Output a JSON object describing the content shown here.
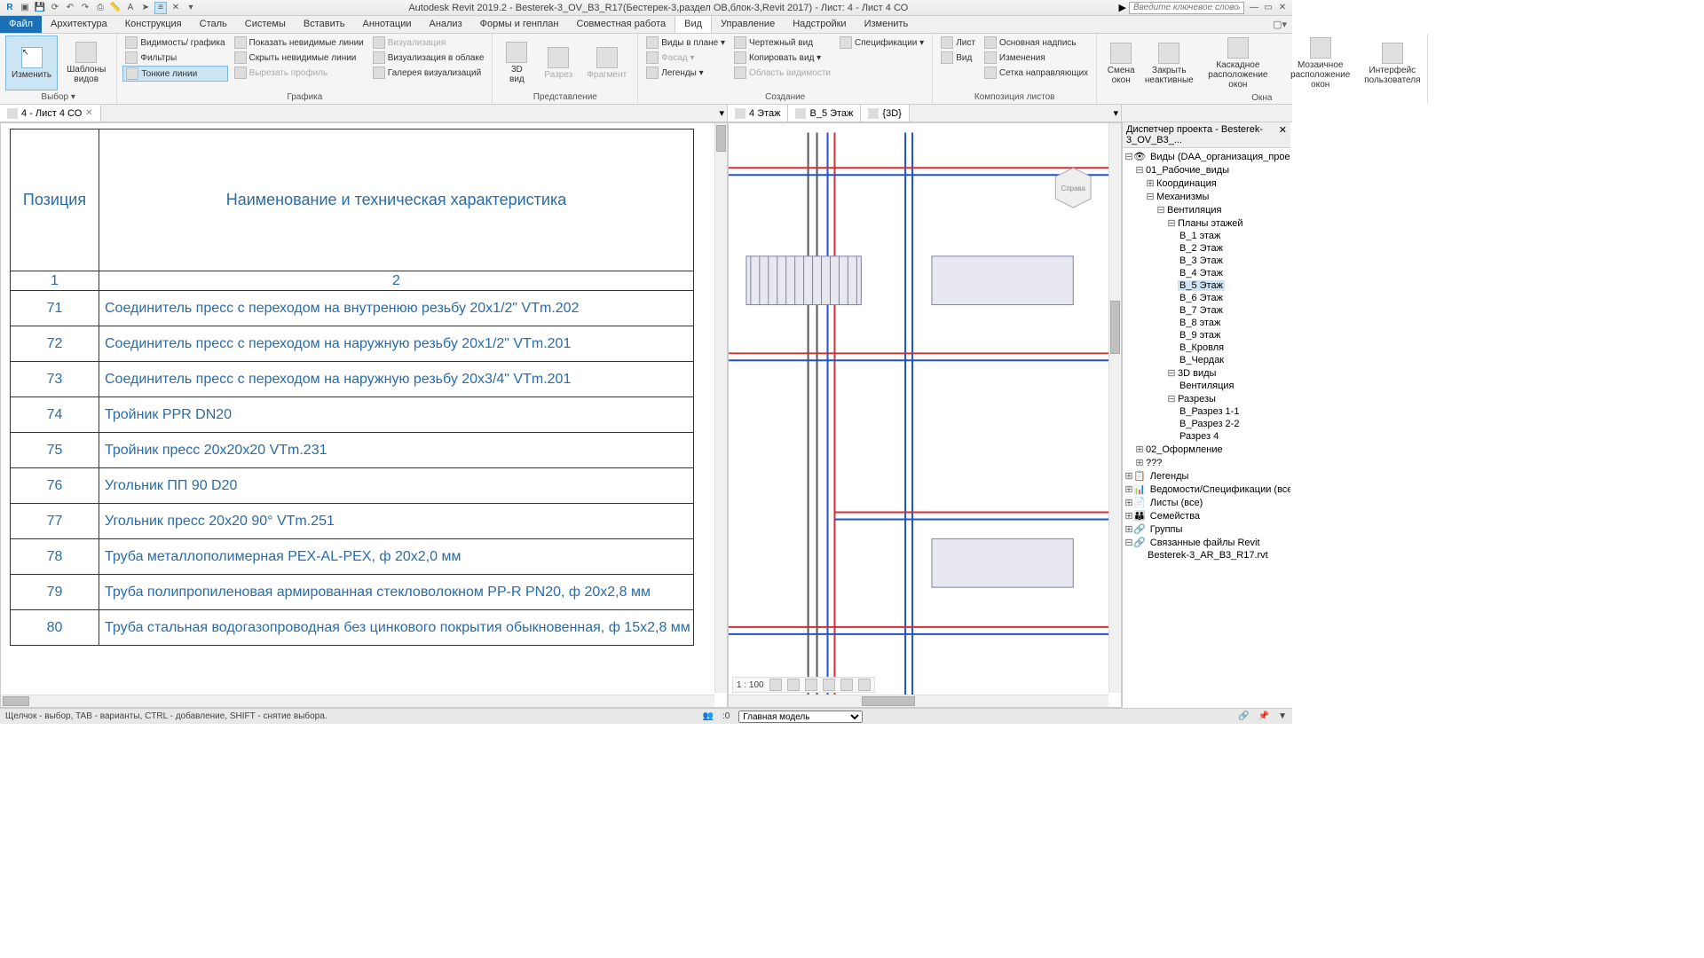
{
  "app_title": "Autodesk Revit 2019.2 - Besterek-3_OV_B3_R17(Бестерек-3,раздел ОВ,блок-3,Revit 2017) - Лист: 4 - Лист 4 СО",
  "search_placeholder": "Введите ключевое слово/фразу",
  "ribbon_tabs": {
    "file": "Файл",
    "items": [
      "Архитектура",
      "Конструкция",
      "Сталь",
      "Системы",
      "Вставить",
      "Аннотации",
      "Анализ",
      "Формы и генплан",
      "Совместная работа",
      "Вид",
      "Управление",
      "Надстройки",
      "Изменить"
    ],
    "active": "Вид"
  },
  "ribbon": {
    "select": {
      "modify": "Изменить",
      "templates": "Шаблоны\nвидов",
      "label": "Выбор ▾"
    },
    "graphics": {
      "vg": "Видимость/ графика",
      "filters": "Фильтры",
      "thin": "Тонкие линии",
      "show": "Показать невидимые линии",
      "hide": "Скрыть невидимые линии",
      "cut": "Вырезать профиль",
      "render": "Визуализация",
      "cloud": "Визуализация в облаке",
      "gallery": "Галерея визуализаций",
      "label": "Графика"
    },
    "present": {
      "v3d": "3D\nвид",
      "section": "Разрез",
      "fragment": "Фрагмент",
      "label": "Представление"
    },
    "create": {
      "plan": "Виды в плане ▾",
      "facade": "Фасад ▾",
      "legends": "Легенды ▾",
      "draft": "Чертежный вид",
      "dup": "Копировать вид ▾",
      "scope": "Область видимости",
      "sched": "Спецификации ▾",
      "label": "Создание"
    },
    "sheets": {
      "sheet": "Лист",
      "view": "Вид",
      "title": "Основная надпись",
      "rev": "Изменения",
      "guide": "Сетка направляющих",
      "label": "Композиция листов"
    },
    "windows": {
      "switch": "Смена\nокон",
      "close": "Закрыть\nнеактивные",
      "cascade": "Каскадное\nрасположение окон",
      "tile": "Мозаичное\nрасположение окон",
      "ui": "Интерфейс\nпользователя",
      "label": "Окна"
    }
  },
  "view_tabs": {
    "left": "4 - Лист 4 СО",
    "right": [
      "4 Этаж",
      "B_5 Этаж",
      "{3D}"
    ]
  },
  "sheet": {
    "h1": "Позиция",
    "h2": "Наименование и техническая характеристика",
    "n1": "1",
    "n2": "2",
    "rows": [
      {
        "p": "71",
        "d": "Соединитель пресс с переходом на внутренюю резьбу 20x1/2\" VTm.202"
      },
      {
        "p": "72",
        "d": "Соединитель пресс с переходом на наружную резьбу 20x1/2\" VTm.201"
      },
      {
        "p": "73",
        "d": "Соединитель пресс с переходом на наружную резьбу 20x3/4\" VTm.201"
      },
      {
        "p": "74",
        "d": "Тройник PPR DN20"
      },
      {
        "p": "75",
        "d": "Тройник пресс 20x20x20 VTm.231"
      },
      {
        "p": "76",
        "d": "Угольник ПП 90 D20"
      },
      {
        "p": "77",
        "d": "Угольник пресс 20x20 90° VTm.251"
      },
      {
        "p": "78",
        "d": "Труба металлополимерная PEX-AL-PEX, ф 20x2,0 мм"
      },
      {
        "p": "79",
        "d": "Труба полипропиленовая армированная стекловолокном PP-R PN20, ф 20x2,8 мм"
      },
      {
        "p": "80",
        "d": "Труба стальная водогазопроводная без цинкового покрытия обыкновенная, ф 15x2,8 мм"
      }
    ]
  },
  "browser": {
    "title": "Диспетчер проекта - Besterek-3_OV_B3_...",
    "views_root": "Виды (DAA_организация_проекта)",
    "n01": "01_Рабочие_виды",
    "coord": "Координация",
    "mech": "Механизмы",
    "vent": "Вентиляция",
    "plans": "Планы этажей",
    "floors": [
      "В_1 этаж",
      "В_2 Этаж",
      "В_3 Этаж",
      "В_4 Этаж",
      "В_5 Этаж",
      "В_6 Этаж",
      "В_7 Этаж",
      "В_8 этаж",
      "В_9 этаж",
      "В_Кровля",
      "В_Чердак"
    ],
    "v3d": "3D виды",
    "vent3d": "Вентиляция",
    "sections": "Разрезы",
    "sec_items": [
      "В_Разрез 1-1",
      "В_Разрез 2-2",
      "Разрез 4"
    ],
    "n02": "02_Оформление",
    "q": "???",
    "legends": "Легенды",
    "schedules": "Ведомости/Спецификации (все)",
    "sheets": "Листы (все)",
    "families": "Семейства",
    "groups": "Группы",
    "links": "Связанные файлы Revit",
    "link1": "Besterek-3_AR_B3_R17.rvt"
  },
  "scale": "1 : 100",
  "status": {
    "hint": "Щелчок - выбор, TAB - варианты, CTRL - добавление, SHIFT - снятие выбора.",
    "main": "Главная модель",
    "zero": ":0"
  }
}
